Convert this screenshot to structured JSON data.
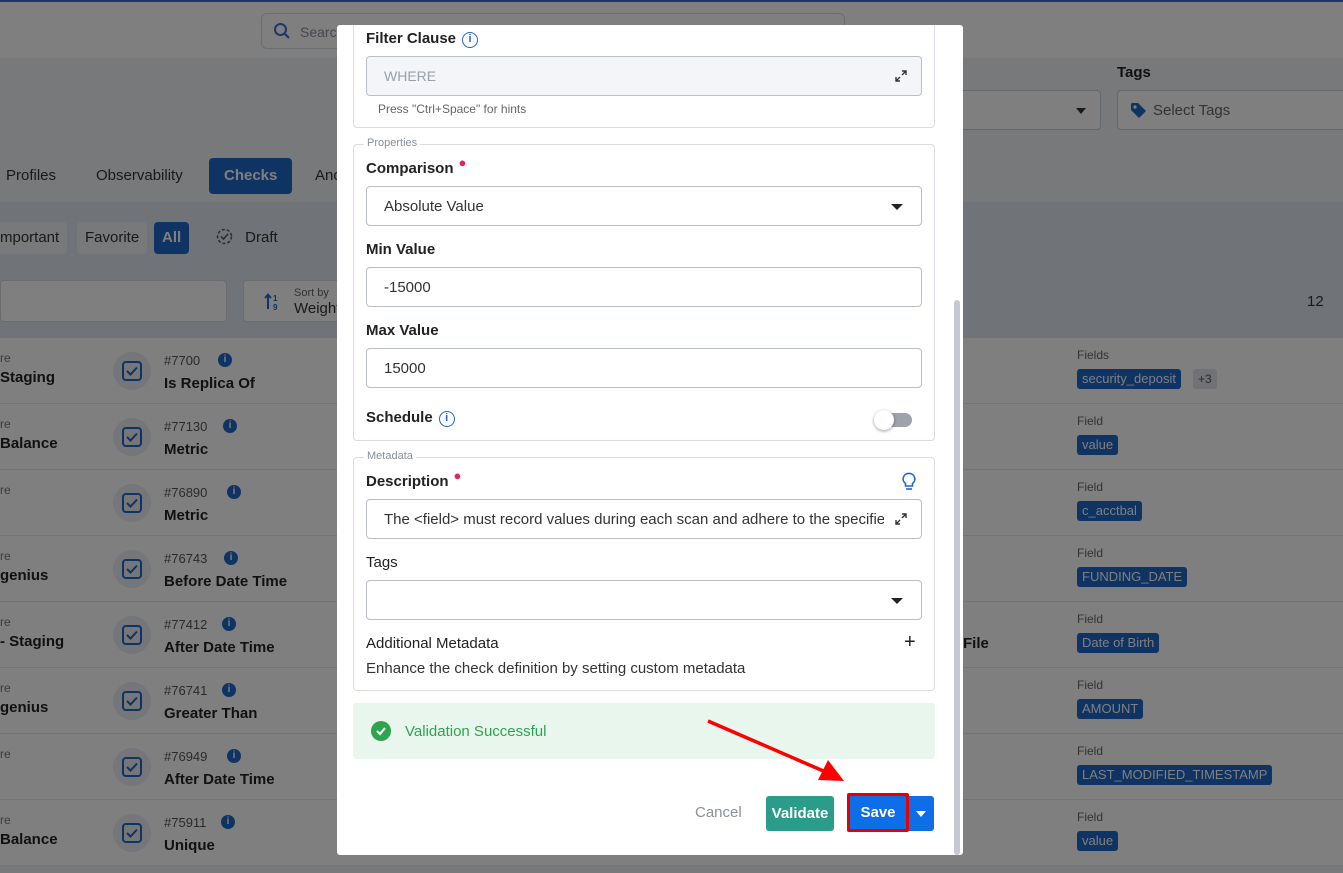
{
  "background": {
    "search_placeholder": "Search",
    "tags_label": "Tags",
    "tags_placeholder": "Select Tags",
    "tabs": [
      "Profiles",
      "Observability",
      "Checks",
      "Ano"
    ],
    "chips": [
      "mportant",
      "Favorite",
      "All"
    ],
    "draft_label": "Draft",
    "sort_by_label": "Sort by",
    "sort_by_value": "Weight",
    "page_count": "12",
    "rows": [
      {
        "src_top": "re",
        "src": "Staging",
        "id": "#7700",
        "name": "Is Replica Of",
        "field_label": "Fields",
        "field": "security_deposit",
        "field_extra": "+3",
        "extra": ""
      },
      {
        "src_top": "re",
        "src": "Balance",
        "id": "#77130",
        "name": "Metric",
        "field_label": "Field",
        "field": "value",
        "field_extra": "",
        "extra": ""
      },
      {
        "src_top": "re",
        "src": "",
        "id": "#76890",
        "name": "Metric",
        "field_label": "Field",
        "field": "c_acctbal",
        "field_extra": "",
        "extra": ""
      },
      {
        "src_top": "re",
        "src": "genius",
        "id": "#76743",
        "name": "Before Date Time",
        "field_label": "Field",
        "field": "FUNDING_DATE",
        "field_extra": "",
        "extra": ""
      },
      {
        "src_top": "re",
        "src": "- Staging",
        "id": "#77412",
        "name": "After Date Time",
        "field_label": "Field",
        "field": "Date of Birth",
        "field_extra": "",
        "extra": "File"
      },
      {
        "src_top": "re",
        "src": "genius",
        "id": "#76741",
        "name": "Greater Than",
        "field_label": "Field",
        "field": "AMOUNT",
        "field_extra": "",
        "extra": ""
      },
      {
        "src_top": "re",
        "src": "",
        "id": "#76949",
        "name": "After Date Time",
        "field_label": "Field",
        "field": "LAST_MODIFIED_TIMESTAMP",
        "field_extra": "",
        "extra": ""
      },
      {
        "src_top": "re",
        "src": "Balance",
        "id": "#75911",
        "name": "Unique",
        "field_label": "Field",
        "field": "value",
        "field_extra": "",
        "extra": ""
      }
    ]
  },
  "modal": {
    "filter_clause_label": "Filter Clause",
    "filter_clause_placeholder": "WHERE",
    "filter_hint": "Press \"Ctrl+Space\" for hints",
    "properties_legend": "Properties",
    "comparison_label": "Comparison",
    "comparison_value": "Absolute Value",
    "min_value_label": "Min Value",
    "min_value": "-15000",
    "max_value_label": "Max Value",
    "max_value": "15000",
    "schedule_label": "Schedule",
    "schedule_enabled": false,
    "metadata_legend": "Metadata",
    "description_label": "Description",
    "description_value": "The <field> must record values during each scan and adhere to the specified",
    "tags_label": "Tags",
    "tags_value": "",
    "additional_metadata_label": "Additional Metadata",
    "additional_metadata_desc": "Enhance the check definition by setting custom metadata",
    "validation_message": "Validation Successful",
    "cancel_label": "Cancel",
    "validate_label": "Validate",
    "save_label": "Save"
  },
  "colors": {
    "primary": "#1f66c4",
    "save": "#0d6ee8",
    "validate": "#2c9c8a",
    "success": "#2ea44f",
    "highlight": "#e60000"
  }
}
